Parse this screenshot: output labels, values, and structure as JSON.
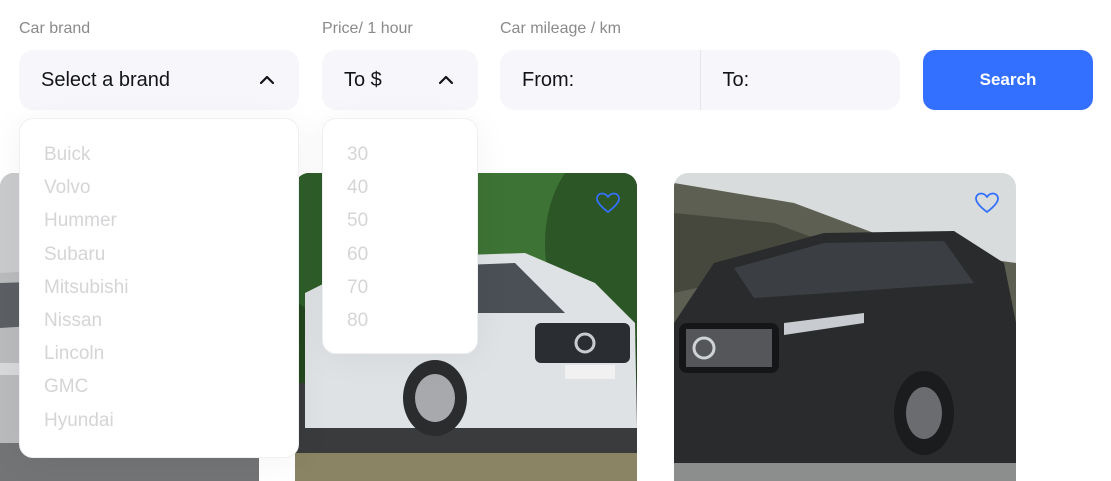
{
  "filters": {
    "brand": {
      "label": "Car brand",
      "value": "Select a brand",
      "options": [
        "Buick",
        "Volvo",
        "Hummer",
        "Subaru",
        "Mitsubishi",
        "Nissan",
        "Lincoln",
        "GMC",
        "Hyundai"
      ]
    },
    "price": {
      "label": "Price/ 1 hour",
      "value": "To $",
      "options": [
        "30",
        "40",
        "50",
        "60",
        "70",
        "80"
      ]
    },
    "mileage": {
      "label": "Car mileage / km",
      "from_label": "From:",
      "to_label": "To:"
    },
    "search_label": "Search"
  },
  "colors": {
    "accent": "#3470ff",
    "field_bg": "#f7f7fb",
    "label": "#8a8a89",
    "option": "#d5d5d7"
  },
  "cards": [
    {
      "image": "silver-minivan-photo"
    },
    {
      "image": "white-volvo-xc90-photo",
      "favorite_icon": "heart-outline-icon"
    },
    {
      "image": "dark-volvo-xc60-photo",
      "favorite_icon": "heart-outline-icon"
    }
  ]
}
